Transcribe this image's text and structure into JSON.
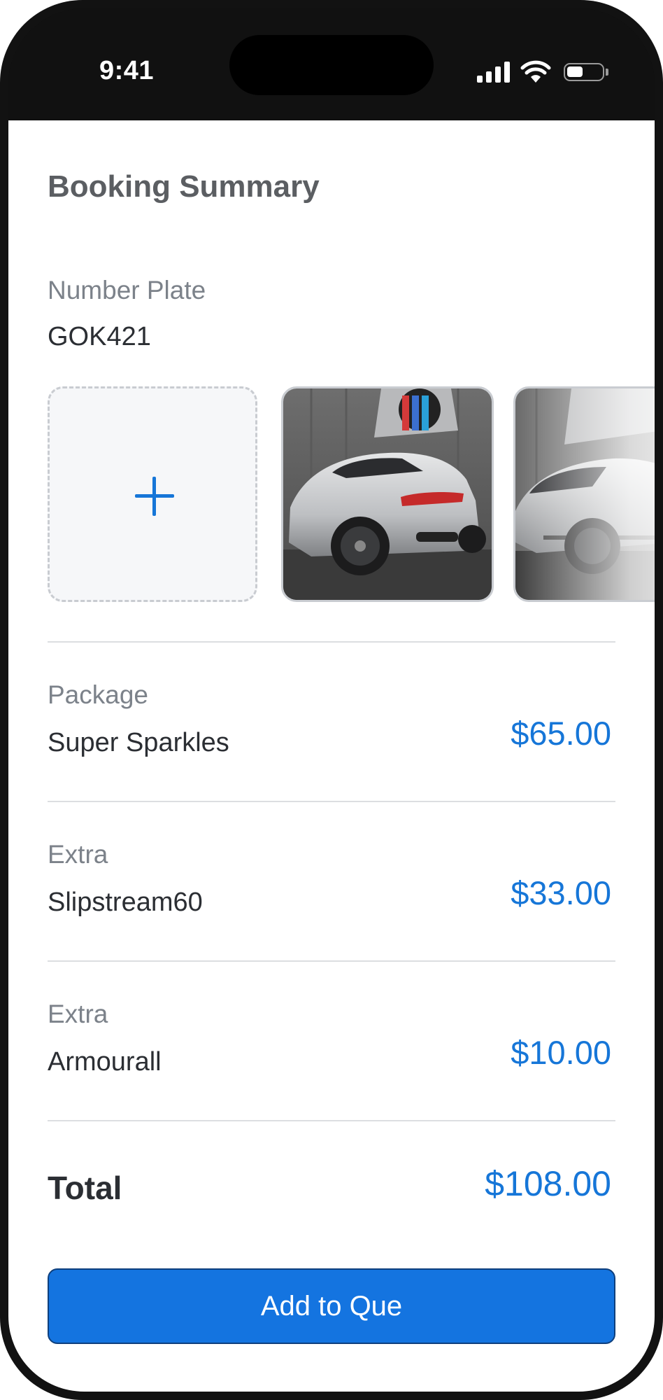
{
  "status_bar": {
    "time": "9:41",
    "icons": [
      "signal-icon",
      "wifi-icon",
      "battery-icon"
    ]
  },
  "page": {
    "title": "Booking Summary"
  },
  "vehicle": {
    "plate_label": "Number Plate",
    "plate_value": "GOK421",
    "add_photo_icon": "plus-icon",
    "photos": [
      "car-photo-rear-silver",
      "car-photo-side-silver"
    ]
  },
  "items": [
    {
      "label": "Package",
      "name": "Super Sparkles",
      "price": "$65.00"
    },
    {
      "label": "Extra",
      "name": "Slipstream60",
      "price": "$33.00"
    },
    {
      "label": "Extra",
      "name": "Armourall",
      "price": "$10.00"
    }
  ],
  "total": {
    "label": "Total",
    "price": "$108.00"
  },
  "cta": {
    "label": "Add to Que"
  },
  "colors": {
    "accent": "#1676D8",
    "button": "#1474E0",
    "text": "#2B2E33",
    "muted": "#7C828A",
    "frame": "#121212"
  }
}
